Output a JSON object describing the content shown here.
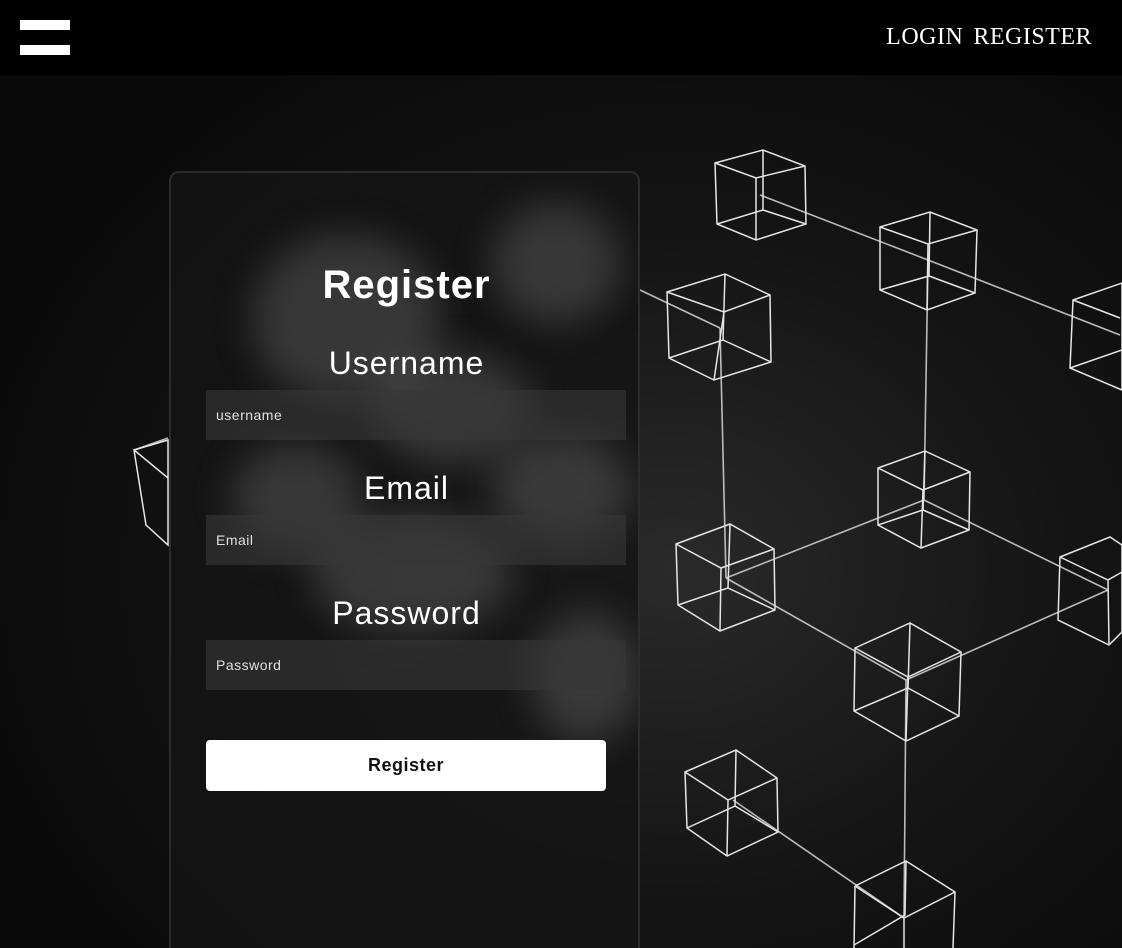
{
  "header": {
    "menu_icon": "hamburger-menu-icon",
    "nav": [
      {
        "label": "LOGIN"
      },
      {
        "label": "REGISTER"
      }
    ]
  },
  "form": {
    "title": "Register",
    "fields": [
      {
        "label": "Username",
        "placeholder": "username"
      },
      {
        "label": "Email",
        "placeholder": "Email"
      },
      {
        "label": "Password",
        "placeholder": "Password"
      }
    ],
    "submit_label": "Register"
  },
  "theme": {
    "background": "#0b0b0b",
    "topbar": "#000000",
    "button_bg": "#ffffff",
    "text": "#ffffff"
  }
}
